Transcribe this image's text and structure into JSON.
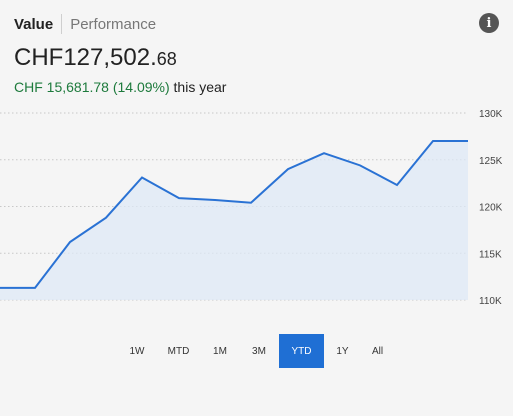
{
  "tabs": {
    "value": "Value",
    "performance": "Performance"
  },
  "info_icon_glyph": "i",
  "balance": {
    "main": "CHF127,502.",
    "cents": "68"
  },
  "change": {
    "amount": "CHF 15,681.78 (14.09%)",
    "suffix": "this year"
  },
  "colors": {
    "line": "#2a72d4",
    "area": "#dde8f5",
    "active_range": "#1f6fd4",
    "positive": "#1d7a3c"
  },
  "ranges": [
    {
      "label": "1W",
      "active": false
    },
    {
      "label": "MTD",
      "active": false
    },
    {
      "label": "1M",
      "active": false
    },
    {
      "label": "3M",
      "active": false
    },
    {
      "label": "YTD",
      "active": true
    },
    {
      "label": "1Y",
      "active": false
    },
    {
      "label": "All",
      "active": false
    }
  ],
  "chart_data": {
    "type": "area",
    "y_ticks": [
      "130K",
      "125K",
      "120K",
      "115K",
      "110K"
    ],
    "ylim": [
      110000,
      130000
    ],
    "grid": true,
    "values": [
      111300,
      111300,
      116200,
      118800,
      123100,
      120900,
      120700,
      120400,
      124000,
      125700,
      124400,
      122300,
      127000,
      127000
    ]
  }
}
